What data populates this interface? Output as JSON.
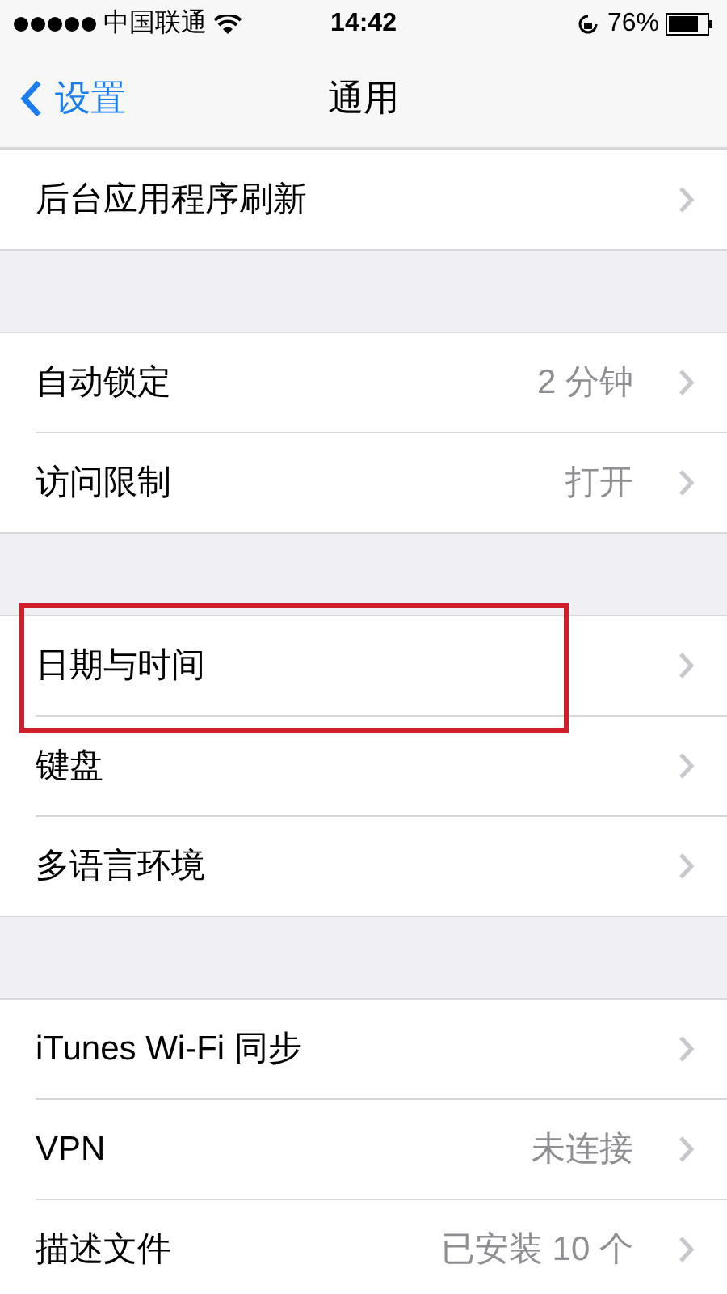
{
  "status_bar": {
    "carrier": "中国联通",
    "time": "14:42",
    "battery": "76%"
  },
  "nav": {
    "back": "设置",
    "title": "通用"
  },
  "sections": [
    {
      "rows": [
        {
          "label": "后台应用程序刷新",
          "highlighted": false
        }
      ]
    },
    {
      "rows": [
        {
          "label": "自动锁定",
          "value": "2 分钟",
          "highlighted": false
        },
        {
          "label": "访问限制",
          "value": "打开",
          "highlighted": false
        }
      ]
    },
    {
      "rows": [
        {
          "label": "日期与时间",
          "highlighted": true
        },
        {
          "label": "键盘",
          "highlighted": false
        },
        {
          "label": "多语言环境",
          "highlighted": false
        }
      ]
    },
    {
      "rows": [
        {
          "label": "iTunes Wi-Fi 同步",
          "highlighted": false
        },
        {
          "label": "VPN",
          "value": "未连接",
          "highlighted": false
        },
        {
          "label": "描述文件",
          "value": "已安装 10 个",
          "highlighted": false
        }
      ]
    }
  ]
}
